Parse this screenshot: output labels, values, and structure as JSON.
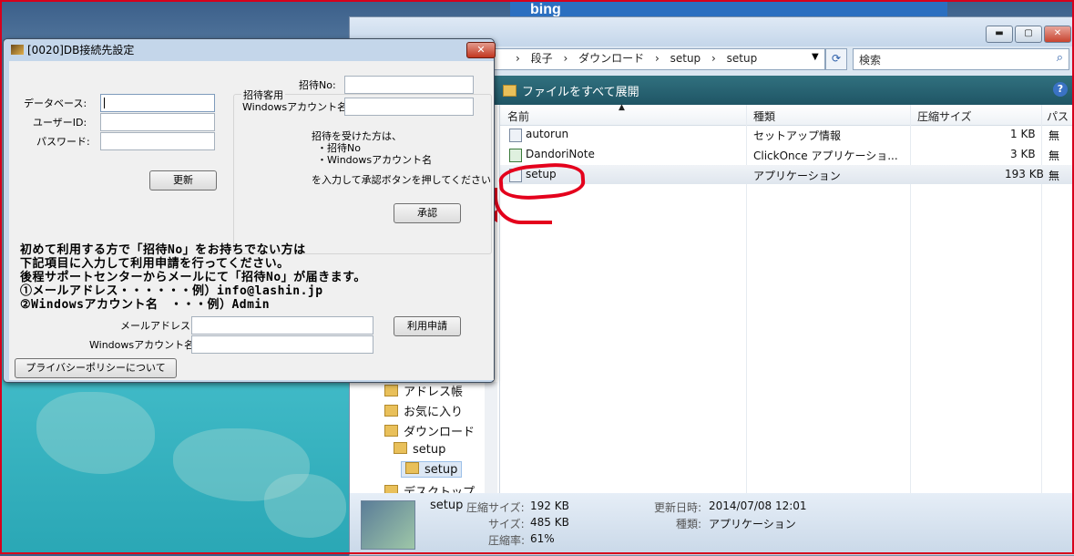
{
  "dialog": {
    "title": "[0020]DB接続先設定",
    "close_label": "✕",
    "db_label": "データベース:",
    "user_label": "ユーザーID:",
    "pass_label": "パスワード:",
    "update_button": "更新",
    "invite_group": {
      "title": "招待客用",
      "no_label": "招待No:",
      "win_label": "Windowsアカウント名:",
      "note1": "招待を受けた方は、",
      "note2": "・招待No",
      "note3": "・Windowsアカウント名",
      "note4": "を入力して承認ボタンを押してください",
      "approve_button": "承認"
    },
    "message_lines": [
      "初めて利用する方で「招待No」をお持ちでない方は",
      "下記項目に入力して利用申請を行ってください。",
      "後程サポートセンターからメールにて「招待No」が届きます。",
      "①メールアドレス・・・・・・例）info@lashin.jp",
      "②Windowsアカウント名　・・・例）Admin"
    ],
    "mail_label": "メールアドレス:",
    "win2_label": "Windowsアカウント名:",
    "apply_button": "利用申請",
    "privacy_button": "プライバシーポリシーについて"
  },
  "explorer": {
    "breadcrumb": [
      "段子",
      "ダウンロード",
      "setup",
      "setup"
    ],
    "search_placeholder": "検索",
    "expand_all": "ファイルをすべて展開",
    "columns": [
      "名前",
      "種類",
      "圧縮サイズ",
      "パス"
    ],
    "files": [
      {
        "name": "autorun",
        "type": "セットアップ情報",
        "size": "1 KB",
        "pass": "無"
      },
      {
        "name": "DandoriNote",
        "type": "ClickOnce アプリケーショ...",
        "size": "3 KB",
        "pass": "無"
      },
      {
        "name": "setup",
        "type": "アプリケーション",
        "size": "193 KB",
        "pass": "無"
      }
    ],
    "nav_items": [
      "アドレス帳",
      "お気に入り",
      "ダウンロード",
      "setup",
      "setup",
      "デスクトップ"
    ],
    "status": {
      "name": "setup",
      "csize_label": "圧縮サイズ:",
      "csize": "192 KB",
      "size_label": "サイズ:",
      "size": "485 KB",
      "ratio_label": "圧縮率:",
      "ratio": "61%",
      "date_label": "更新日時:",
      "date": "2014/07/08 12:01",
      "type_label": "種類:",
      "type": "アプリケーション"
    }
  },
  "browser": {
    "logo": "bing"
  },
  "colors": {
    "highlight": "#e4001c",
    "cmdbar": "#1f5565"
  }
}
